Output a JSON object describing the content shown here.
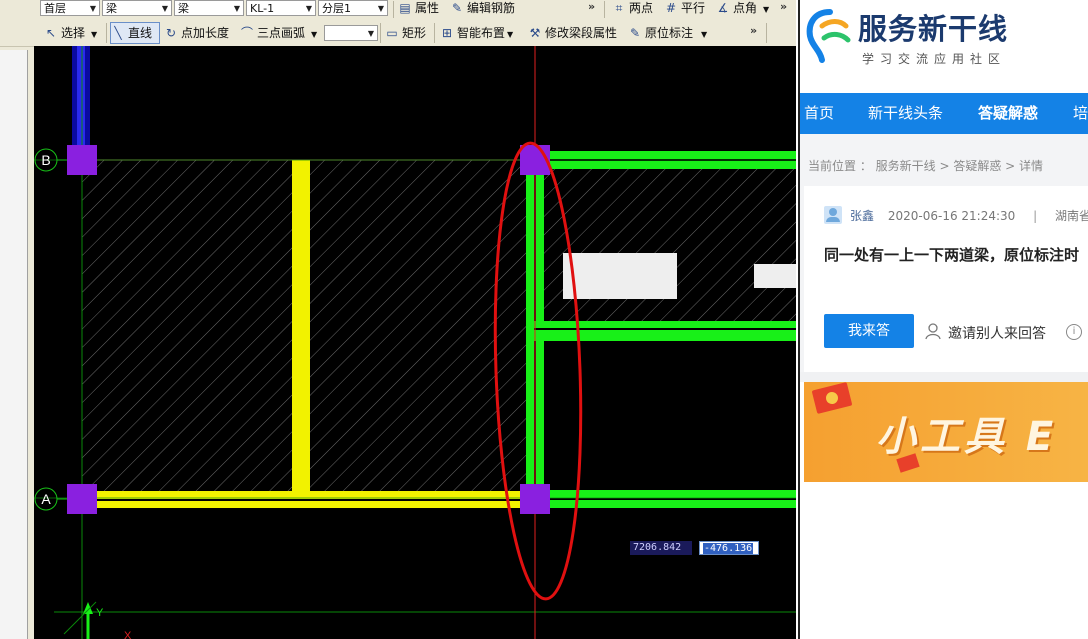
{
  "toolbar1": {
    "floor_select": "首层",
    "type_select1": "梁",
    "type_select2": "梁",
    "member_select": "KL-1",
    "sublayer_select": "分层1",
    "properties": "属性",
    "edit_rebar": "编辑钢筋",
    "two_points": "两点",
    "parallel": "平行",
    "point_angle": "点角",
    "more": "»"
  },
  "toolbar2": {
    "select": "选择",
    "line": "直线",
    "point_length": "点加长度",
    "three_point_arc": "三点画弧",
    "rectangle": "矩形",
    "smart_layout": "智能布置",
    "modify_span_props": "修改梁段属性",
    "in_situ_annotation": "原位标注",
    "more": "»"
  },
  "canvas": {
    "axis_b": "B",
    "axis_a": "A",
    "coord_x": "7206.842",
    "coord_y": "-476.136",
    "ucs_y": "Y",
    "ucs_x": "X"
  },
  "colors": {
    "beam_yellow": "#f2f200",
    "beam_green": "#18f018",
    "column_purple": "#8a20e0",
    "annotation_red": "#e01010",
    "nav_blue": "#1482e6"
  },
  "web": {
    "logo_title": "服务新干线",
    "logo_subtitle": "学习交流应用社区",
    "nav": [
      "首页",
      "新干线头条",
      "答疑解惑",
      "培"
    ],
    "breadcrumb": "当前位置 ： 服务新干线 > 答疑解惑 > 详情",
    "author": "张鑫",
    "date": "2020-06-16 21:24:30",
    "divider": "|",
    "location": "湖南省",
    "question_title": "同一处有一上一下两道梁，原位标注时",
    "answer_button": "我来答",
    "invite": "邀请别人来回答",
    "banner_text": "小工具 E"
  }
}
